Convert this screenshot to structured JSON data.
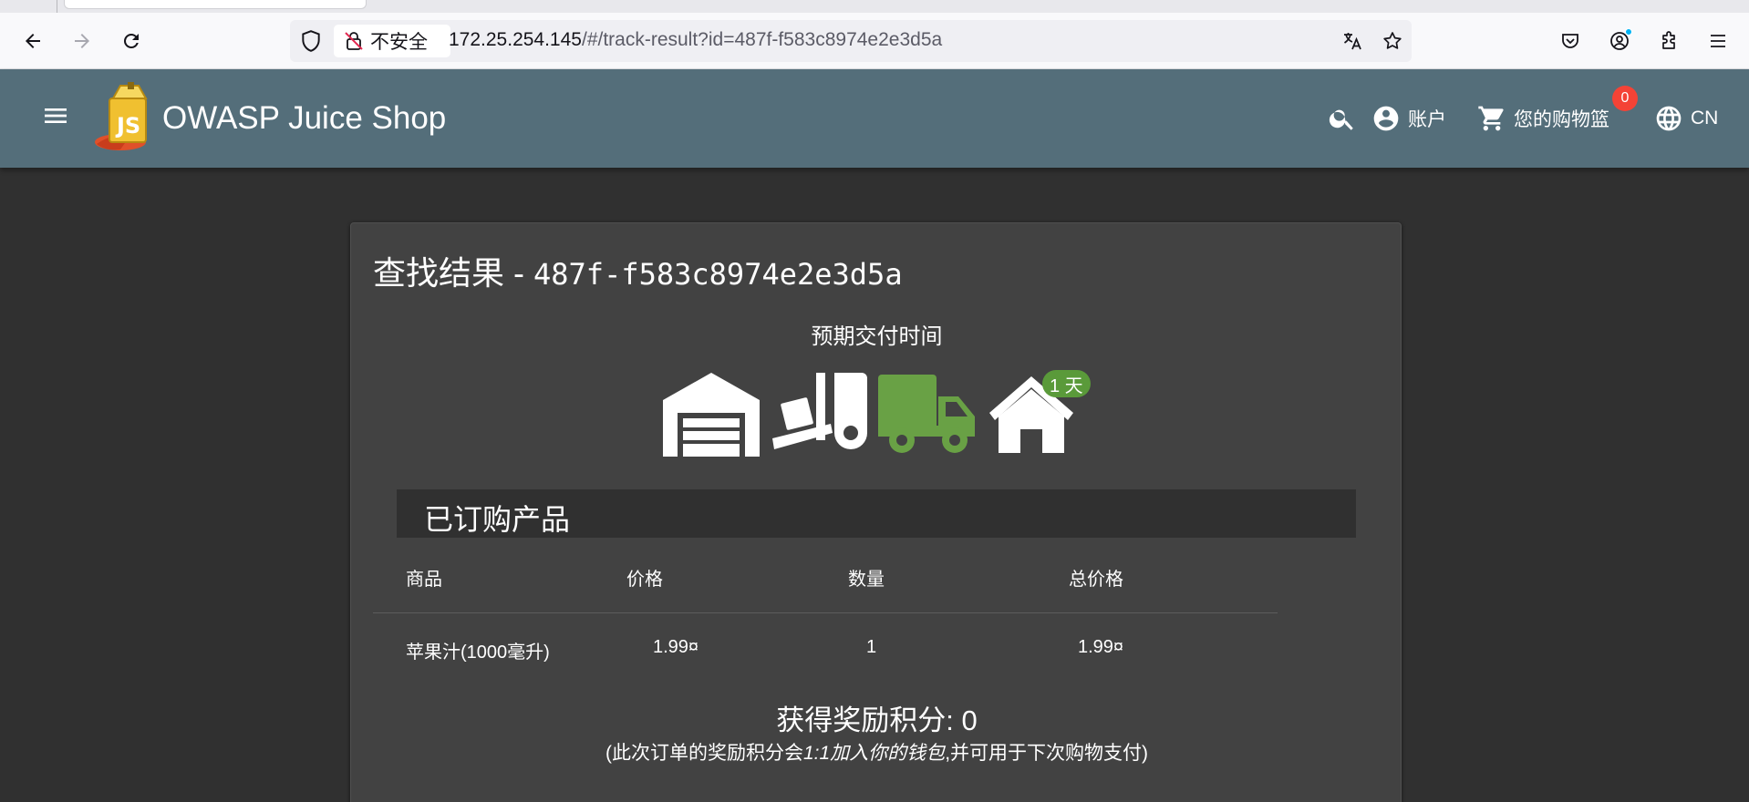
{
  "browser": {
    "security_label": "不安全",
    "url_host": "172.25.254.145",
    "url_path": "/#/track-result?id=487f-f583c8974e2e3d5a"
  },
  "app": {
    "title": "OWASP Juice Shop",
    "nav": {
      "account_label": "账户",
      "basket_label": "您的购物篮",
      "basket_count": "0",
      "language_label": "CN"
    }
  },
  "tracking": {
    "title_prefix": "查找结果 - ",
    "order_id": "487f-f583c8974e2e3d5a",
    "eta_label": "预期交付时间",
    "days_label": "1 天",
    "active_stage": "in-transit",
    "active_color": "#69a145",
    "stages": [
      "warehouse",
      "packed",
      "in-transit",
      "delivered"
    ]
  },
  "products": {
    "section_title": "已订购产品",
    "columns": [
      "商品",
      "价格",
      "数量",
      "总价格"
    ],
    "rows": [
      {
        "name": "苹果汁(1000毫升)",
        "price": "1.99¤",
        "quantity": "1",
        "total": "1.99¤"
      }
    ]
  },
  "bonus": {
    "label": "获得奖励积分: 0",
    "note_before": "(此次订单的奖励积分会",
    "note_emphasis": "1:1加入你的钱包",
    "note_after": ",并可用于下次购物支付)"
  }
}
